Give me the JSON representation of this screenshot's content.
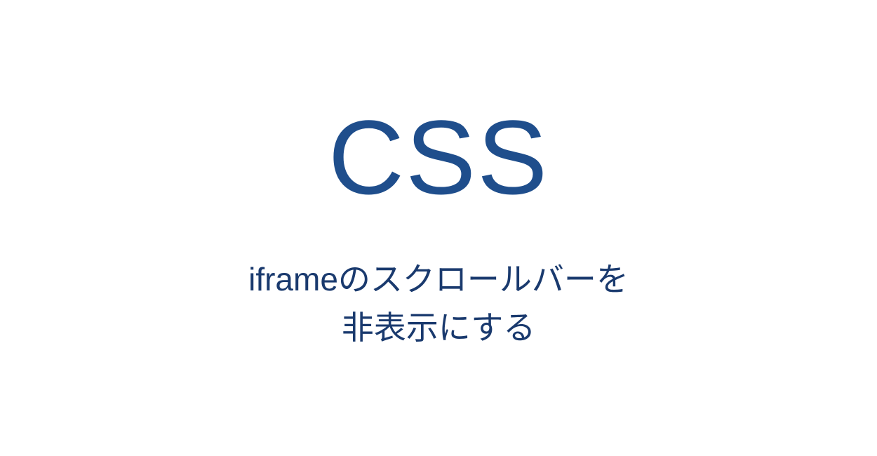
{
  "title": "CSS",
  "subtitle": {
    "line1": "iframeのスクロールバーを",
    "line2": "非表示にする"
  },
  "colors": {
    "title_color": "#1f4e8c",
    "subtitle_color": "#1a3a6e",
    "background": "#ffffff"
  }
}
